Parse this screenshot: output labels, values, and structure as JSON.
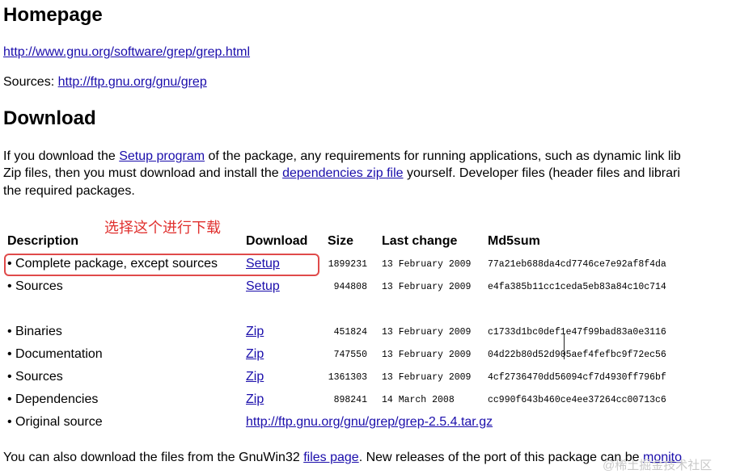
{
  "homepage": {
    "heading": "Homepage",
    "url": "http://www.gnu.org/software/grep/grep.html",
    "sources_label": "Sources:",
    "sources_url": "http://ftp.gnu.org/gnu/grep"
  },
  "download": {
    "heading": "Download",
    "para": {
      "t1": "If you download the ",
      "link1": "Setup program",
      "t2": " of the package, any requirements for running applications, such as dynamic link lib",
      "t3": "Zip files, then you must download and install the ",
      "link2": "dependencies zip file",
      "t4": " yourself. Developer files (header files and librari",
      "t5": "the required packages."
    },
    "annotation": "选择这个进行下载",
    "table": {
      "headers": {
        "description": "Description",
        "download": "Download",
        "size": "Size",
        "last_change": "Last change",
        "md5": "Md5sum"
      },
      "rows": [
        {
          "description": "• Complete package, except sources",
          "link": "Setup",
          "size": "1899231",
          "date": "13 February 2009",
          "md5": "77a21eb688da4cd7746ce7e92af8f4da"
        },
        {
          "description": "• Sources",
          "link": "Setup",
          "size": "944808",
          "date": "13 February 2009",
          "md5": "e4fa385b11cc1ceda5eb83a84c10c714"
        },
        {
          "description": "• Binaries",
          "link": "Zip",
          "size": "451824",
          "date": "13 February 2009",
          "md5": "c1733d1bc0def1e47f99bad83a0e3116"
        },
        {
          "description": "• Documentation",
          "link": "Zip",
          "size": "747550",
          "date": "13 February 2009",
          "md5": "04d22b80d52d905aef4fefbc9f72ec56"
        },
        {
          "description": "• Sources",
          "link": "Zip",
          "size": "1361303",
          "date": "13 February 2009",
          "md5": "4cf2736470dd56094cf7d4930ff796bf"
        },
        {
          "description": "• Dependencies",
          "link": "Zip",
          "size": "898241",
          "date": "14 March 2008",
          "md5": "cc990f643b460ce4ee37264cc00713c6"
        }
      ],
      "original": {
        "description": "• Original source",
        "link": "http://ftp.gnu.org/gnu/grep/grep-2.5.4.tar.gz"
      }
    },
    "footer": {
      "t1": "You can also download the files from the GnuWin32 ",
      "link1": "files page",
      "t2": ". New releases of the port of this package can be ",
      "link2": "monito"
    },
    "watermark": "@稀土掘金技术社区"
  }
}
